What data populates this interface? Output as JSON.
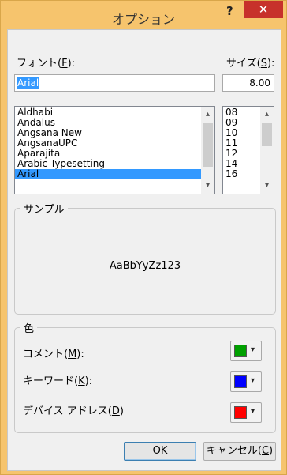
{
  "window": {
    "title": "オプション",
    "help_label": "?",
    "close_label": "✕"
  },
  "font": {
    "label": "フォント(",
    "label_key": "F",
    "label_end": "):",
    "value": "Arial",
    "items": [
      "Aldhabi",
      "Andalus",
      "Angsana New",
      "AngsanaUPC",
      "Aparajita",
      "Arabic Typesetting",
      "Arial"
    ],
    "selected": "Arial"
  },
  "size": {
    "label": "サイズ(",
    "label_key": "S",
    "label_end": "):",
    "value": "8.00",
    "items": [
      "08",
      "09",
      "10",
      "11",
      "12",
      "14",
      "16"
    ]
  },
  "sample": {
    "group_label": "サンプル",
    "text": "AaBbYyZz123"
  },
  "colors": {
    "group_label": "色",
    "comment": {
      "label": "コメント(",
      "key": "M",
      "end": "):",
      "color": "#00a000"
    },
    "keyword": {
      "label": "キーワード(",
      "key": "K",
      "end": "):",
      "color": "#0000ff"
    },
    "device": {
      "label": "デバイス アドレス(",
      "key": "D",
      "end": ")",
      "color": "#ff0000"
    }
  },
  "buttons": {
    "ok": "OK",
    "cancel": "キャンセル(",
    "cancel_key": "C",
    "cancel_end": ")"
  },
  "icons": {
    "dropdown": "▾",
    "scroll_up": "▴",
    "scroll_down": "▾"
  }
}
